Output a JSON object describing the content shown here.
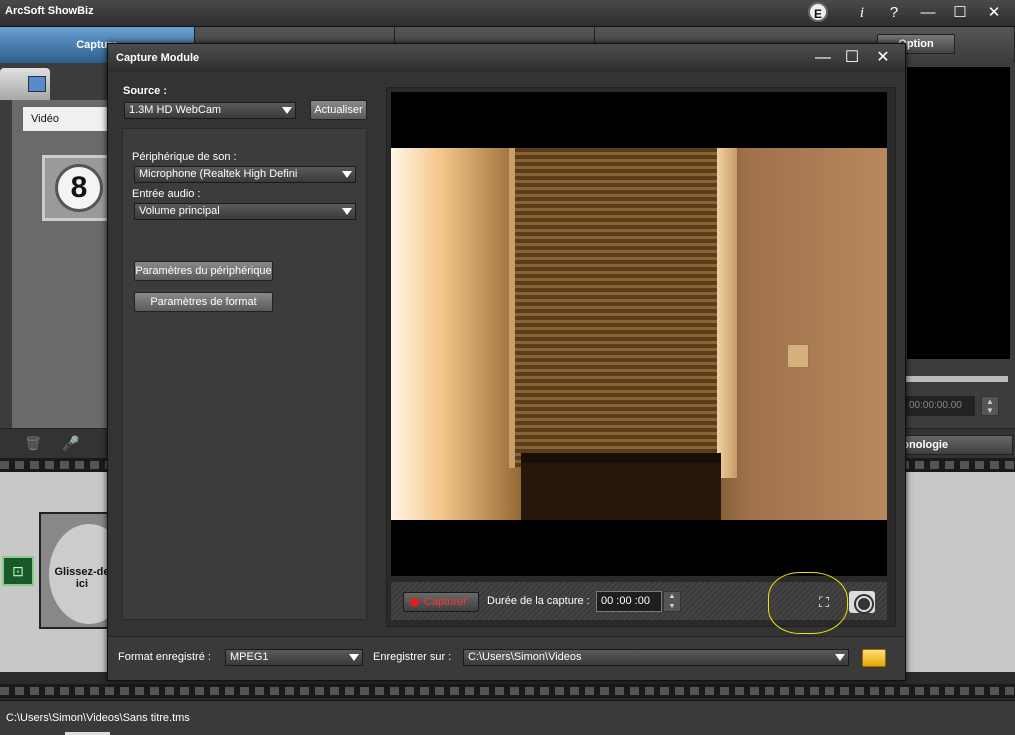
{
  "app": {
    "title": "ArcSoft ShowBiz",
    "e_badge": "E",
    "info": "i",
    "help": "?",
    "minimize": "—",
    "maximize": "☐",
    "close": "✕"
  },
  "main_tabs": [
    {
      "label": "Capture",
      "active": true
    },
    {
      "label": "",
      "active": false
    },
    {
      "label": "",
      "active": false
    }
  ],
  "option_button": "Option",
  "left_panel": {
    "select_value": "Vidéo",
    "thumbnail_number": "8"
  },
  "right_panel": {
    "timecode": "00:00:00.00"
  },
  "chronologie_button": "ronologie",
  "storyboard": {
    "drop_text": "Glissez-de ici"
  },
  "status": {
    "path": "C:\\Users\\Simon\\Videos\\Sans titre.tms"
  },
  "dialog": {
    "title": "Capture Module",
    "minimize": "—",
    "maximize": "☐",
    "close": "✕",
    "source_label": "Source :",
    "source_value": "1.3M HD WebCam",
    "refresh_button": "Actualiser",
    "audio_device_label": "Périphérique de son :",
    "audio_device_value": "Microphone (Realtek High Defini",
    "audio_input_label": "Entrée audio :",
    "audio_input_value": "Volume principal",
    "device_params_button": "Paramètres du périphérique",
    "format_params_button": "Paramètres de format",
    "capture_button": "Capturer",
    "duration_label": "Durée de la capture :",
    "duration_value": "00 :00 :00",
    "format_label": "Format enregistré :",
    "format_value": "MPEG1",
    "save_label": "Enregistrer sur :",
    "save_value": "C:\\Users\\Simon\\Videos"
  },
  "colors": {
    "accent_tab": "#2c5d8d",
    "record_red": "#e21b1b",
    "highlight_yellow": "#e6e600"
  }
}
